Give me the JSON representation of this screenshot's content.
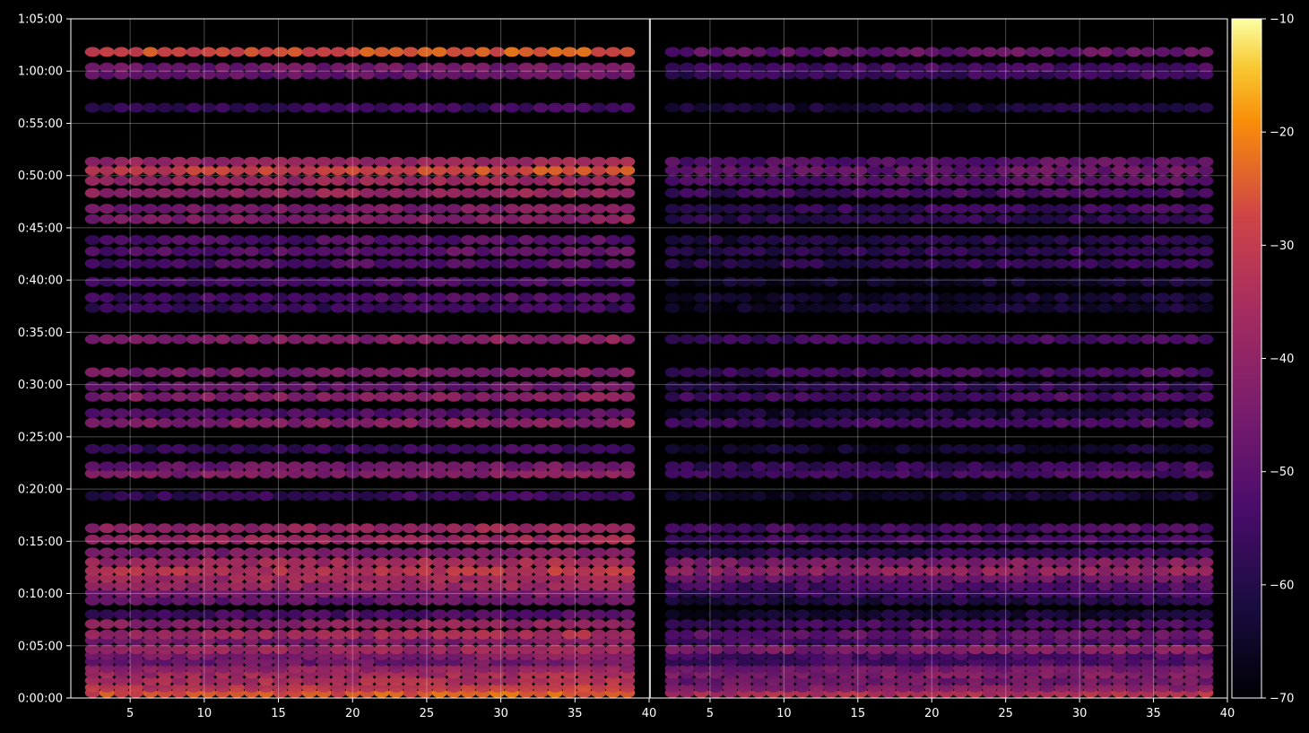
{
  "chart_data": {
    "type": "heatmap",
    "title": "",
    "colormap": "inferno",
    "background": "#000000",
    "grid": true,
    "panels": [
      {
        "name": "",
        "xlim": [
          1,
          40
        ],
        "ylim_seconds": [
          0,
          3900
        ],
        "x_ticks": [
          "5",
          "10",
          "15",
          "20",
          "25",
          "30",
          "35",
          "40"
        ],
        "x_tick_values": [
          5,
          10,
          15,
          20,
          25,
          30,
          35,
          40
        ]
      },
      {
        "name": "",
        "xlim": [
          1,
          40
        ],
        "ylim_seconds": [
          0,
          3900
        ],
        "x_ticks": [
          "5",
          "10",
          "15",
          "20",
          "25",
          "30",
          "35",
          "40"
        ],
        "x_tick_values": [
          5,
          10,
          15,
          20,
          25,
          30,
          35,
          40
        ]
      }
    ],
    "y_axis": {
      "ticks": [
        "0:00:00",
        "0:05:00",
        "0:10:00",
        "0:15:00",
        "0:20:00",
        "0:25:00",
        "0:30:00",
        "0:35:00",
        "0:40:00",
        "0:45:00",
        "0:50:00",
        "0:55:00",
        "1:00:00",
        "1:05:00"
      ],
      "tick_seconds": [
        0,
        300,
        600,
        900,
        1200,
        1500,
        1800,
        2100,
        2400,
        2700,
        3000,
        3300,
        3600,
        3900
      ]
    },
    "colorbar": {
      "range": [
        -70,
        -10
      ],
      "ticks": [
        "−10",
        "−20",
        "−30",
        "−40",
        "−50",
        "−60",
        "−70"
      ],
      "tick_values": [
        -10,
        -20,
        -30,
        -40,
        -50,
        -60,
        -70
      ]
    },
    "rows": [
      {
        "t": 30,
        "level": -27,
        "right_level": -35
      },
      {
        "t": 60,
        "level": -33,
        "right_level": -45
      },
      {
        "t": 100,
        "level": -36,
        "right_level": -48
      },
      {
        "t": 140,
        "level": -38,
        "right_level": -45
      },
      {
        "t": 170,
        "level": -42,
        "right_level": -48
      },
      {
        "t": 210,
        "level": -48,
        "right_level": -55
      },
      {
        "t": 245,
        "level": -45,
        "right_level": -55
      },
      {
        "t": 280,
        "level": -40,
        "right_level": -45
      },
      {
        "t": 330,
        "level": -46,
        "right_level": -55
      },
      {
        "t": 365,
        "level": -38,
        "right_level": -50
      },
      {
        "t": 425,
        "level": -42,
        "right_level": -55
      },
      {
        "t": 480,
        "level": -55,
        "right_level": -65
      },
      {
        "t": 560,
        "level": -50,
        "right_level": -62
      },
      {
        "t": 605,
        "level": -46,
        "right_level": -58
      },
      {
        "t": 645,
        "level": -40,
        "right_level": -55
      },
      {
        "t": 690,
        "level": -38,
        "right_level": -50
      },
      {
        "t": 730,
        "level": -34,
        "right_level": -42
      },
      {
        "t": 780,
        "level": -38,
        "right_level": -45
      },
      {
        "t": 835,
        "level": -45,
        "right_level": -60
      },
      {
        "t": 910,
        "level": -40,
        "right_level": -55
      },
      {
        "t": 975,
        "level": -40,
        "right_level": -55
      },
      {
        "t": 1160,
        "level": -58,
        "right_level": -66
      },
      {
        "t": 1290,
        "level": -44,
        "right_level": -56
      },
      {
        "t": 1330,
        "level": -48,
        "right_level": -58
      },
      {
        "t": 1430,
        "level": -58,
        "right_level": -66
      },
      {
        "t": 1580,
        "level": -44,
        "right_level": -56
      },
      {
        "t": 1635,
        "level": -54,
        "right_level": -64
      },
      {
        "t": 1730,
        "level": -44,
        "right_level": -56
      },
      {
        "t": 1790,
        "level": -50,
        "right_level": -60
      },
      {
        "t": 1870,
        "level": -46,
        "right_level": -56
      },
      {
        "t": 2060,
        "level": -44,
        "right_level": -56
      },
      {
        "t": 2240,
        "level": -58,
        "right_level": -66
      },
      {
        "t": 2300,
        "level": -55,
        "right_level": -66
      },
      {
        "t": 2390,
        "level": -56,
        "right_level": -66
      },
      {
        "t": 2495,
        "level": -54,
        "right_level": -60
      },
      {
        "t": 2565,
        "level": -52,
        "right_level": -60
      },
      {
        "t": 2630,
        "level": -54,
        "right_level": -62
      },
      {
        "t": 2750,
        "level": -44,
        "right_level": -60
      },
      {
        "t": 2810,
        "level": -46,
        "right_level": -58
      },
      {
        "t": 2900,
        "level": -40,
        "right_level": -56
      },
      {
        "t": 2970,
        "level": -40,
        "right_level": -52
      },
      {
        "t": 3030,
        "level": -30,
        "right_level": -50
      },
      {
        "t": 3080,
        "level": -40,
        "right_level": -52
      },
      {
        "t": 3390,
        "level": -58,
        "right_level": -64
      },
      {
        "t": 3580,
        "level": -50,
        "right_level": -58
      },
      {
        "t": 3620,
        "level": -48,
        "right_level": -56
      },
      {
        "t": 3710,
        "level": -28,
        "right_level": -50
      }
    ]
  }
}
